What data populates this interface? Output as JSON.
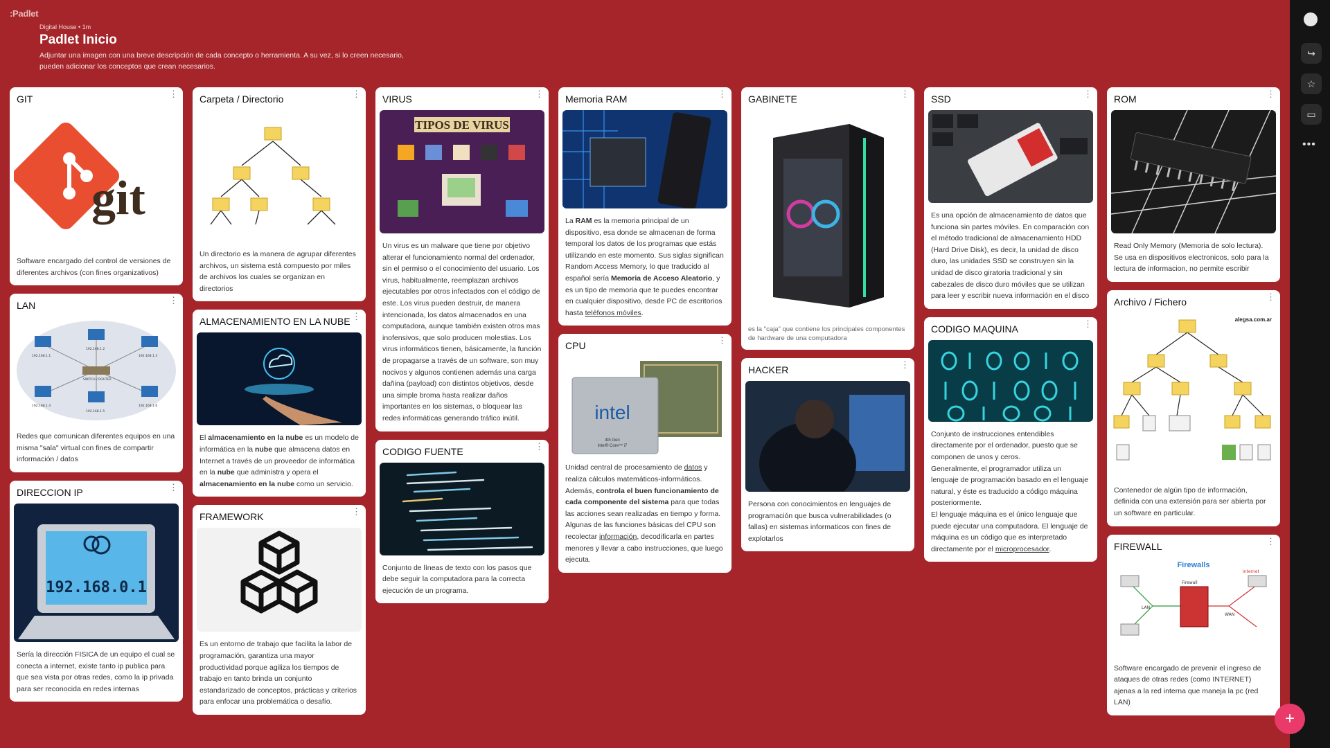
{
  "app": {
    "logo": ":Padlet"
  },
  "header": {
    "meta": "Digital House • 1m",
    "title": "Padlet Inicio",
    "description": "Adjuntar una imagen con una breve descripción de cada concepto o herramienta. A su vez, si lo creen necesario, pueden adicionar los conceptos que crean necesarios."
  },
  "cards": {
    "git": {
      "title": "GIT",
      "text": "Software encargado del control de versiones de diferentes archivos (con fines organizativos)"
    },
    "lan": {
      "title": "LAN",
      "text": "Redes que comunican diferentes equipos en una misma \"sala\" virtual con fines de compartir información / datos",
      "img_labels": [
        "192.168.1.1",
        "192.168.1.2",
        "192.168.1.3",
        "SWITCH / ROUTER",
        "192.168.1.4",
        "192.168.1.5",
        "192.168.1.6"
      ]
    },
    "ip": {
      "title": "DIRECCION IP",
      "text": "Sería la dirección FISICA de un equipo el cual se conecta a internet, existe tanto ip publica para que sea vista por otras redes, como la ip privada para ser reconocida en redes internas",
      "img_text": "192.168.0.1"
    },
    "carpeta": {
      "title": "Carpeta / Directorio",
      "text": "Un directorio es la manera de agrupar diferentes archivos, un sistema está compuesto por miles de archivos los cuales se organizan en directorios"
    },
    "nube": {
      "title": "ALMACENAMIENTO EN LA NUBE",
      "t1": "El ",
      "b1": "almacenamiento en la nube",
      "t2": " es un modelo de informática en la ",
      "b2": "nube",
      "t3": " que almacena datos en Internet a través de un proveedor de informática en la ",
      "b3": "nube",
      "t4": " que administra y opera el ",
      "b4": "almacenamiento en la nube",
      "t5": " como un servicio."
    },
    "framework": {
      "title": "FRAMEWORK",
      "text": "Es un entorno de trabajo que facilita la labor de programación, garantiza una mayor productividad porque agiliza los tiempos de trabajo en tanto brinda un conjunto estandarizado de conceptos, prácticas y criterios para enfocar una problemática o desafío."
    },
    "virus": {
      "title": "VIRUS",
      "img_title": "TIPOS DE VIRUS",
      "text": "Un virus es un malware que tiene por objetivo alterar el funcionamiento normal del ordenador, sin el permiso o el conocimiento del usuario. Los virus, habitualmente, reemplazan archivos ejecutables por otros infectados con el código de este. Los virus pueden destruir, de manera intencionada, los datos almacenados en una computadora, aunque también existen otros mas inofensivos, que solo producen molestias. Los virus informáticos tienen, básicamente, la función de propagarse a través de un software, son muy nocivos y algunos contienen además una carga dañina (payload) con distintos objetivos, desde una simple broma hasta realizar daños importantes en los sistemas, o bloquear las redes informáticas generando tráfico inútil."
    },
    "codigo_fuente": {
      "title": "CODIGO FUENTE",
      "text": "Conjunto de líneas de texto con los pasos que debe seguir la computadora para la correcta ejecución de un programa."
    },
    "ram": {
      "title": "Memoria RAM",
      "t1": "La ",
      "b1": "RAM",
      "t2": " es la memoria principal de un dispositivo, esa donde se almacenan de forma temporal los datos de los programas que estás utilizando en este momento. Sus siglas significan Random Access Memory, lo que traducido al español sería ",
      "b2": "Memoria de Acceso Aleatorio",
      "t3": ", y es un tipo de memoria que te puedes encontrar en cualquier dispositivo, desde PC de escritorios hasta ",
      "link": "teléfonos móviles",
      "t4": "."
    },
    "cpu": {
      "title": "CPU",
      "img_brand": "intel",
      "img_sub": "4th Gen",
      "img_model": "Intel® Core™ i7",
      "t1": "Unidad central de procesamiento de ",
      "link1": "datos",
      "t2": " y realiza cálculos matemáticos-informáticos. Además, ",
      "b1": "controla el buen funcionamiento de cada componente del sistema",
      "t3": " para que todas las acciones sean realizadas en tiempo y forma.",
      "t4": "Algunas de las funciones básicas del CPU son recolectar ",
      "link2": "información",
      "t5": ", decodificarla en partes menores y llevar a cabo instrucciones, que luego ejecuta."
    },
    "gabinete": {
      "title": "GABINETE",
      "text": "es la \"caja\" que contiene los principales componentes de hardware de una computadora"
    },
    "hacker": {
      "title": "HACKER",
      "text": "Persona con conocimientos en lenguajes de programación que busca vulnerabilidades (o fallas) en sistemas informaticos con fines de explotarlos"
    },
    "ssd": {
      "title": "SSD",
      "text": "Es una opción de almacenamiento de datos que funciona sin partes móviles. En comparación con el método tradicional de almacenamiento HDD (Hard Drive Disk), es decir, la unidad de disco duro, las unidades SSD se construyen sin la unidad de disco giratoria tradicional y sin cabezales de disco duro móviles que se utilizan para leer y escribir nueva información en el disco"
    },
    "maquina": {
      "title": "CODIGO MAQUINA",
      "p1": "Conjunto de instrucciones entendibles directamente por el ordenador, puesto que se componen de unos y ceros.",
      "p2": "Generalmente, el programador utiliza un lenguaje de programación basado en el lenguaje natural, y éste es traducido a código máquina posteriormente.",
      "p3a": "El lenguaje máquina es el único lenguaje que puede ejecutar una computadora. El lenguaje de máquina es un código que es interpretado directamente por el ",
      "link": "microprocesador",
      "p3b": "."
    },
    "rom": {
      "title": "ROM",
      "text": "Read Only Memory (Memoria de solo lectura). Se usa en dispositivos electronicos, solo para la lectura de informacion, no permite escribir"
    },
    "archivo": {
      "title": "Archivo / Fichero",
      "img_credit": "alegsa.com.ar",
      "text": "Contenedor de algún tipo de información, definida con una extensión para ser abierta por un software en particular."
    },
    "firewall": {
      "title": "FIREWALL",
      "img_title": "Firewalls",
      "img_labels": [
        "Internet",
        "Firewall",
        "LAN",
        "WAN"
      ],
      "text": "Software encargado de prevenir el ingreso de ataques de otras redes (como INTERNET) ajenas a la red interna que maneja la pc (red LAN)"
    }
  },
  "fab": {
    "label": "+"
  },
  "colors": {
    "background": "#a5252a",
    "rail": "#141414",
    "fab": "#e93a6a"
  }
}
